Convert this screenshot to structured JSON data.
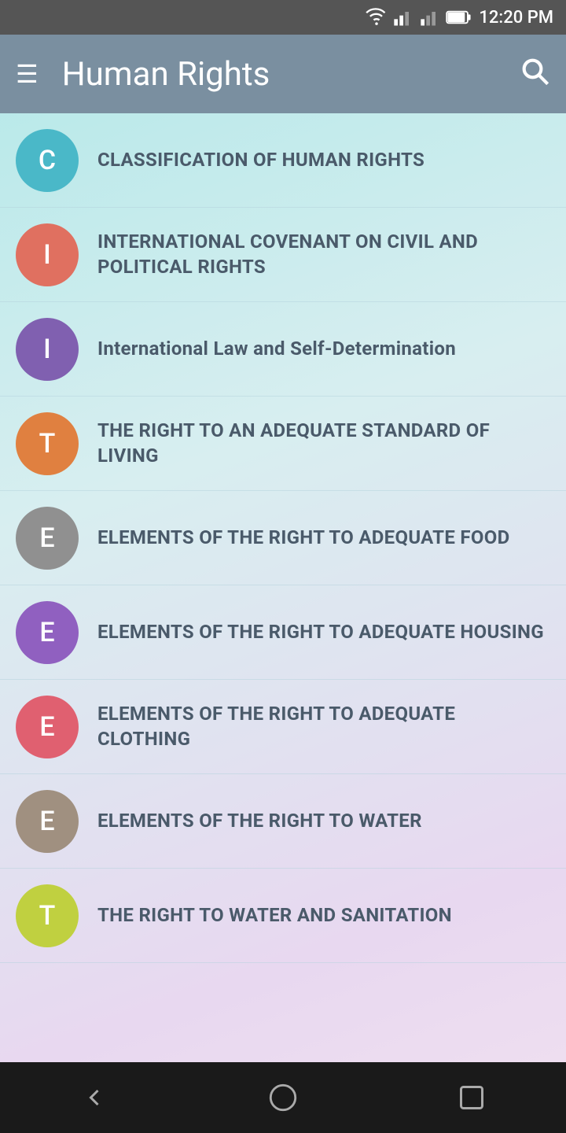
{
  "statusBar": {
    "time": "12:20 PM"
  },
  "appBar": {
    "title": "Human Rights",
    "menuIcon": "☰",
    "searchIcon": "🔍"
  },
  "listItems": [
    {
      "id": "classification",
      "avatarLetter": "C",
      "avatarColor": "#4ab8c8",
      "text": "CLASSIFICATION OF HUMAN RIGHTS",
      "uppercase": true
    },
    {
      "id": "covenant",
      "avatarLetter": "I",
      "avatarColor": "#e07060",
      "text": "INTERNATIONAL COVENANT ON CIVIL AND POLITICAL RIGHTS",
      "uppercase": true
    },
    {
      "id": "intl-law",
      "avatarLetter": "I",
      "avatarColor": "#8060b0",
      "text": "International Law and Self-Determination",
      "uppercase": false
    },
    {
      "id": "adequate-living",
      "avatarLetter": "T",
      "avatarColor": "#e08040",
      "text": "THE RIGHT TO AN ADEQUATE STANDARD OF LIVING",
      "uppercase": true
    },
    {
      "id": "food",
      "avatarLetter": "E",
      "avatarColor": "#909090",
      "text": "ELEMENTS OF THE RIGHT TO ADEQUATE FOOD",
      "uppercase": true
    },
    {
      "id": "housing",
      "avatarLetter": "E",
      "avatarColor": "#9060c0",
      "text": "ELEMENTS OF THE RIGHT TO ADEQUATE HOUSING",
      "uppercase": true
    },
    {
      "id": "clothing",
      "avatarLetter": "E",
      "avatarColor": "#e06070",
      "text": "ELEMENTS OF THE RIGHT TO ADEQUATE CLOTHING",
      "uppercase": true
    },
    {
      "id": "water",
      "avatarLetter": "E",
      "avatarColor": "#a09080",
      "text": "ELEMENTS OF THE RIGHT TO WATER",
      "uppercase": true
    },
    {
      "id": "water-sanitation",
      "avatarLetter": "T",
      "avatarColor": "#c0d040",
      "text": "THE RIGHT TO WATER AND SANITATION",
      "uppercase": true
    }
  ],
  "bottomNav": {
    "backLabel": "back",
    "homeLabel": "home",
    "recentLabel": "recent"
  }
}
